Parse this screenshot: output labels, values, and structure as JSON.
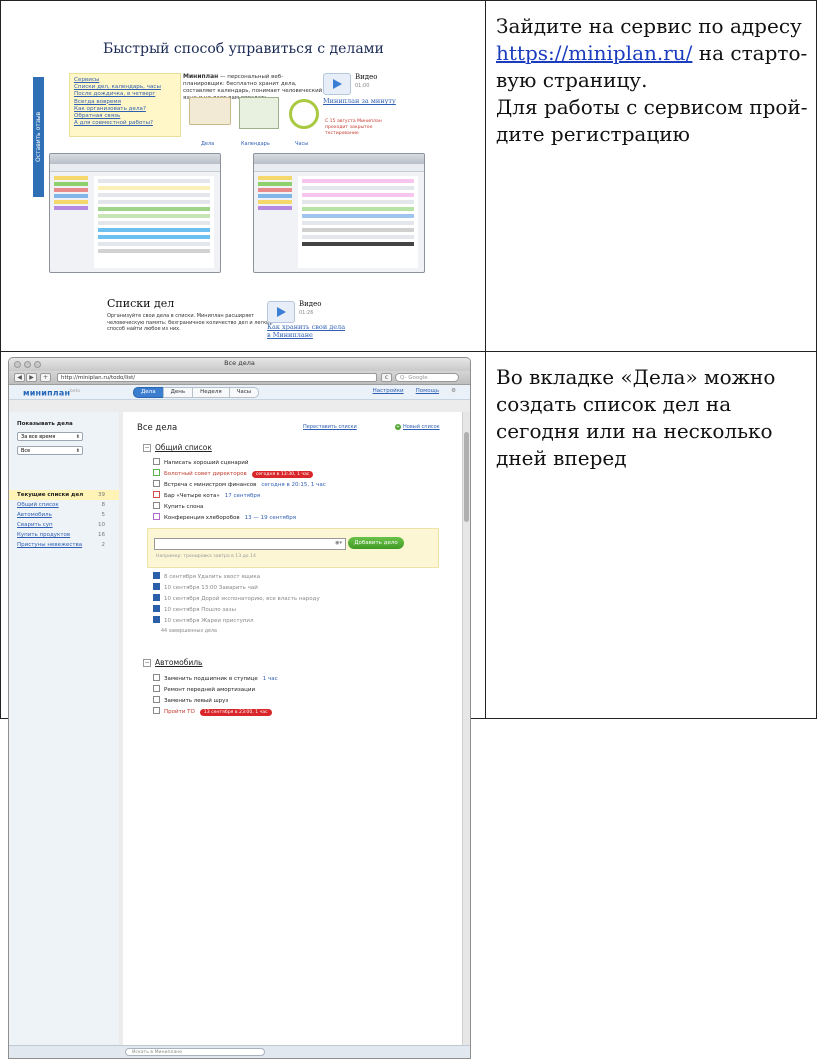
{
  "cells": {
    "top_text_before_link": "Зайдите на сервис по адресу",
    "top_link": "https://miniplan.ru/",
    "top_text_after_link": " на старто-вую страницу.",
    "top_text_second": "Для работы с сервисом прой-дите регистрацию",
    "bottom_text": "Во вкладке «Дела» можно создать список дел на сегодня или на несколько дней вперед"
  },
  "site": {
    "headline": "Быстрый способ управиться с делами",
    "vertical_label": "Оставить отзыв",
    "menu": [
      "Сервисы",
      "Списки дел, календарь, часы",
      "После дождичка, в четверг",
      "Всегда вовремя",
      "Как организовать дела?",
      "Обратная связь",
      "А для совместной работы?"
    ],
    "desc_brand": "Миниплан",
    "desc_text": " — персональный веб-планировщик: бесплатно хранит дела, составляет календарь, понимает человеческий язык и не дает вам опоздать.",
    "ill_captions": [
      "Дела",
      "Календарь",
      "Часы"
    ],
    "video1_title": "Видео",
    "video1_duration": "01:00",
    "video1_link": "Миниплан за минуту",
    "promo": "С 15 августа Миниплан проходит закрытое тестирование",
    "heading2": "Списки дел",
    "text2": "Организуйте свои дела в списки. Миниплан расширяет человеческую память: безграничное количество дел и легкий способ найти любое из них.",
    "video2_title": "Видео",
    "video2_duration": "01:26",
    "video2_link": "Как хранить свои дела в Миниплане"
  },
  "app": {
    "window_title": "Все дела",
    "url": "http://miniplan.ru/todo/list/",
    "search_placeholder": "Q- Google",
    "logo": "миниплан",
    "logo_beta": "beta",
    "tabs": [
      "Дела",
      "День",
      "Неделя",
      "Часы"
    ],
    "settings": "Настройки",
    "help": "Помощь",
    "show_label": "Показывать дела",
    "filter1": "За все время",
    "filter2": "Все",
    "lists": [
      {
        "label": "Текущие списки дел",
        "count": "39"
      },
      {
        "label": "Общий список",
        "count": "8"
      },
      {
        "label": "Автомобиль",
        "count": "5"
      },
      {
        "label": "Сварить суп",
        "count": "10"
      },
      {
        "label": "Купить продуктов",
        "count": "16"
      },
      {
        "label": "Пристуны невежества",
        "count": "2"
      }
    ],
    "content_title": "Все дела",
    "reorder": "Переставить списки",
    "new_list": "Новый список",
    "section1": "Общий список",
    "tasks1": [
      {
        "text": "Написать хороший сценарий",
        "date": "",
        "badge": ""
      },
      {
        "text": "Болотный совет директоров",
        "date": "",
        "badge": "сегодня в 13:30, 1 час"
      },
      {
        "text": "Встреча с министром финансов",
        "date": "сегодня в 20:15, 1 час",
        "badge": ""
      },
      {
        "text": "Бар «Четыре кота»",
        "date": "17 сентября",
        "badge": ""
      },
      {
        "text": "Купить слона",
        "date": "",
        "badge": ""
      },
      {
        "text": "Конференция хлеборобов",
        "date": "13 — 19 сентября",
        "badge": ""
      }
    ],
    "add_button": "Добавить дело",
    "add_hint": "Например: тренировка завтра в 13 до 14",
    "done_tasks": [
      "8 сентября  Удалить хвост ящика",
      "10 сентября  13:00 Заварить чай",
      "10 сентября  Дорой экспонаторию, все власть народу",
      "10 сентября  Пошло зазы",
      "10 сентября  Жареи приступил"
    ],
    "done_more": "44 завершенных дела",
    "section2": "Автомобиль",
    "tasks2": [
      {
        "text": "Заменить подшипник в ступице",
        "date": "1 час",
        "badge": ""
      },
      {
        "text": "Ремонт передней амортизации",
        "date": "",
        "badge": ""
      },
      {
        "text": "Заменить левый шруз",
        "date": "",
        "badge": ""
      },
      {
        "text": "Пройти ТО",
        "date": "",
        "badge": "13 сентября в 23:00, 1 час"
      }
    ],
    "bottom_search": "Искать в Миниплане"
  }
}
